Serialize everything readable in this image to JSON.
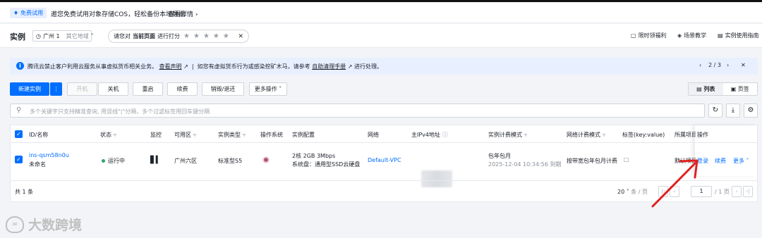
{
  "promo": {
    "badge": "免费试用",
    "text": "邀您免费试用对象存储COS，轻松备份本地数据",
    "link": "查看详情"
  },
  "header": {
    "title": "实例",
    "region": "广州 1",
    "other_region": "其它地域",
    "rate_prompt_pre": "请您对",
    "rate_prompt_bold": "当前页面",
    "rate_prompt_post": "进行打分",
    "links": [
      "限时领福利",
      "场景教学",
      "实例使用指南"
    ]
  },
  "notice": {
    "text_1": "腾讯云禁止客户利用云服务从事虚拟货币相关业务。",
    "link_1": "查看声明",
    "text_2": "如您有虚拟货币行为或感染挖矿木马，请参考",
    "link_2": "自助清理手册",
    "text_3": "进行处理。",
    "page": "2 / 3"
  },
  "toolbar": {
    "new_instance": "新建实例",
    "start": "开机",
    "shutdown": "关机",
    "restart": "重启",
    "renew": "续费",
    "destroy": "销毁/退还",
    "more": "更多操作",
    "view_list": "列表",
    "view_page": "页签"
  },
  "search": {
    "placeholder": "多个关键字只支持精准查询, 用竖线\"|\"分隔，多个过滤标签用回车键分隔"
  },
  "table": {
    "headers": {
      "id": "ID/名称",
      "status": "状态",
      "monitor": "监控",
      "zone": "可用区",
      "type": "实例类型",
      "os": "操作系统",
      "config": "实例配置",
      "network": "网络",
      "ip": "主IPv4地址",
      "billing": "实例计费模式",
      "net_billing": "网络计费模式",
      "tags": "标签(key:value)",
      "project": "所属项目",
      "ops": "操作"
    },
    "row": {
      "id": "ins-qsm58n0u",
      "name": "未命名",
      "status": "运行中",
      "zone": "广州六区",
      "type": "标准型S5",
      "config_1": "2核 2GB 3Mbps",
      "config_2": "系统盘：通用型SSD云硬盘",
      "network": "Default-VPC",
      "billing": "包年包月",
      "expire": "2025-12-04 10:34:56 到期",
      "net_billing": "按带宽包年包月计费",
      "project": "默认项目",
      "op_login": "登录",
      "op_renew": "续费",
      "op_more": "更多"
    },
    "total": "共 1 条",
    "page_size": "20",
    "page_size_unit": "条 / 页",
    "page_current": "1",
    "page_total": "/ 1 页"
  },
  "watermark": "大数跨境",
  "colors": {
    "accent": "#006eff",
    "annotation_arrow": "#e02020"
  }
}
